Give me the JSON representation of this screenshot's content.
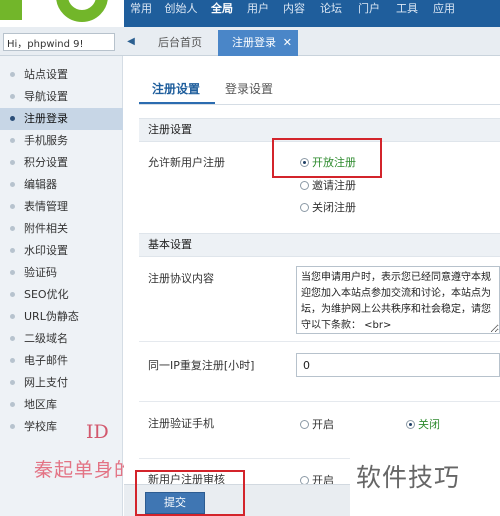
{
  "topnav": {
    "items": [
      "常用",
      "创始人",
      "全局",
      "用户",
      "内容",
      "论坛",
      "门户",
      "工具",
      "应用"
    ],
    "active_index": 2
  },
  "search": {
    "value": "Hi，phpwind 9!"
  },
  "tabs": {
    "home_label": "后台首页",
    "current_label": "注册登录",
    "close_glyph": "✕"
  },
  "sidebar": {
    "items": [
      "站点设置",
      "导航设置",
      "注册登录",
      "手机服务",
      "积分设置",
      "编辑器",
      "表情管理",
      "附件相关",
      "水印设置",
      "验证码",
      "SEO优化",
      "URL伪静态",
      "二级域名",
      "电子邮件",
      "网上支付",
      "地区库",
      "学校库"
    ],
    "active_index": 2
  },
  "watermark": {
    "id": "ID",
    "name": "秦起单身的调"
  },
  "subtabs": {
    "register_settings": "注册设置",
    "login_settings": "登录设置"
  },
  "register_section": {
    "title": "注册设置",
    "allow_label": "允许新用户注册",
    "options": [
      "开放注册",
      "邀请注册",
      "关闭注册"
    ],
    "selected_index": 0
  },
  "basic_section": {
    "title": "基本设置",
    "protocol_label": "注册协议内容",
    "protocol_text": "当您申请用户时，表示您已经同意遵守本规\n迎您加入本站点参加交流和讨论，本站点为\n坛，为维护网上公共秩序和社会稳定，请您\n守以下条款： <br>",
    "same_ip_label": "同一IP重复注册[小时]",
    "same_ip_value": "0",
    "mobile_verify_label": "注册验证手机",
    "mobile_verify_on": "开启",
    "mobile_verify_off": "关闭",
    "review_label": "新用户注册审核",
    "review_on": "开启"
  },
  "footer": {
    "submit_label": "提交"
  },
  "jingyan_watermark": "软件技巧",
  "colors": {
    "topbar": "#1f5e9c",
    "accent": "#2b6cb0",
    "highlight_red": "#d3242b",
    "logo_green": "#72b62a"
  }
}
